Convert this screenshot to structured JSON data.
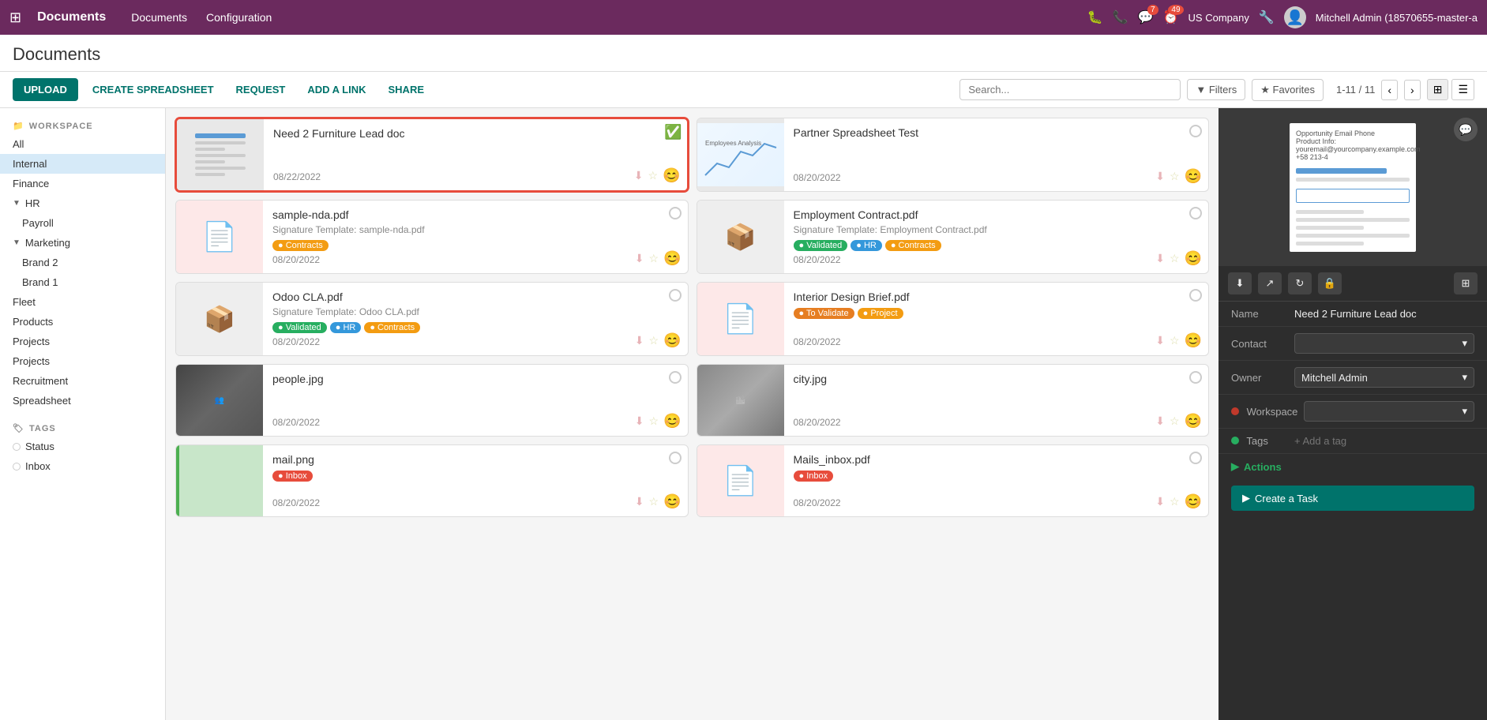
{
  "app": {
    "title": "Documents",
    "nav_items": [
      "Documents",
      "Configuration"
    ]
  },
  "topbar": {
    "company": "US Company",
    "user": "Mitchell Admin (18570655-master-a",
    "notifications_chat": "7",
    "notifications_clock": "49"
  },
  "page": {
    "title": "Documents"
  },
  "toolbar": {
    "upload_label": "UPLOAD",
    "create_spreadsheet_label": "CREATE SPREADSHEET",
    "request_label": "REQUEST",
    "add_link_label": "ADD A LINK",
    "share_label": "SHARE",
    "filter_label": "Filters",
    "favorites_label": "Favorites",
    "pagination": "1-11 / 11",
    "search_placeholder": "Search..."
  },
  "sidebar": {
    "workspace_section": "WORKSPACE",
    "all_label": "All",
    "internal_label": "Internal",
    "finance_label": "Finance",
    "hr_label": "HR",
    "payroll_label": "Payroll",
    "marketing_label": "Marketing",
    "brand2_label": "Brand 2",
    "brand1_label": "Brand 1",
    "fleet_label": "Fleet",
    "products_label": "Products",
    "projects1_label": "Projects",
    "projects2_label": "Projects",
    "recruitment_label": "Recruitment",
    "spreadsheet_label": "Spreadsheet",
    "tags_section": "TAGS",
    "status_label": "Status",
    "inbox_label": "Inbox"
  },
  "documents": [
    {
      "id": "need-furniture",
      "name": "Need 2 Furniture Lead doc",
      "date": "08/22/2022",
      "type": "doc",
      "selected": true,
      "verified": true
    },
    {
      "id": "partner-spreadsheet",
      "name": "Partner Spreadsheet Test",
      "date": "08/20/2022",
      "type": "chart",
      "selected": false
    },
    {
      "id": "sample-nda",
      "name": "sample-nda.pdf",
      "date": "08/20/2022",
      "type": "pdf",
      "sub": "Signature Template: sample-nda.pdf",
      "tags": [
        "Contracts"
      ],
      "tag_colors": [
        "yellow"
      ],
      "selected": false
    },
    {
      "id": "employment-contract",
      "name": "Employment Contract.pdf",
      "date": "08/20/2022",
      "type": "box",
      "sub": "Signature Template: Employment Contract.pdf",
      "tags": [
        "Validated",
        "HR",
        "Contracts"
      ],
      "tag_colors": [
        "green",
        "blue",
        "yellow"
      ],
      "selected": false
    },
    {
      "id": "odoo-cla",
      "name": "Odoo CLA.pdf",
      "date": "08/20/2022",
      "type": "box",
      "sub": "Signature Template: Odoo CLA.pdf",
      "tags": [
        "Validated",
        "HR",
        "Contracts"
      ],
      "tag_colors": [
        "green",
        "blue",
        "yellow"
      ],
      "selected": false
    },
    {
      "id": "interior-design",
      "name": "Interior Design Brief.pdf",
      "date": "08/20/2022",
      "type": "pdf",
      "sub": "",
      "tags": [
        "To Validate",
        "Project"
      ],
      "tag_colors": [
        "orange",
        "yellow"
      ],
      "selected": false
    },
    {
      "id": "people-jpg",
      "name": "people.jpg",
      "date": "08/20/2022",
      "type": "image-people",
      "selected": false
    },
    {
      "id": "city-jpg",
      "name": "city.jpg",
      "date": "08/20/2022",
      "type": "image-city",
      "selected": false
    },
    {
      "id": "mail-png",
      "name": "mail.png",
      "date": "08/20/2022",
      "type": "image-mail",
      "tags": [
        "Inbox"
      ],
      "tag_colors": [
        "red"
      ],
      "selected": false
    },
    {
      "id": "mails-inbox",
      "name": "Mails_inbox.pdf",
      "date": "08/20/2022",
      "type": "pdf",
      "tags": [
        "Inbox"
      ],
      "tag_colors": [
        "red"
      ],
      "selected": false
    }
  ],
  "right_panel": {
    "doc_name_label": "Name",
    "doc_name_value": "Need 2 Furniture Lead doc",
    "contact_label": "Contact",
    "contact_value": "",
    "owner_label": "Owner",
    "owner_value": "Mitchell Admin",
    "workspace_label": "Workspace",
    "workspace_value": "",
    "tags_label": "Tags",
    "tags_placeholder": "+ Add a tag",
    "actions_label": "Actions",
    "create_task_label": "Create a Task"
  }
}
